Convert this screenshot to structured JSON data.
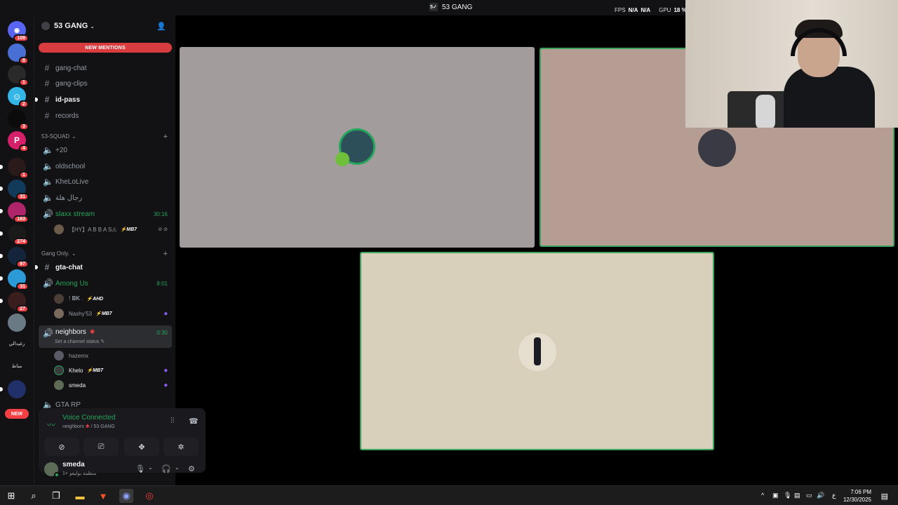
{
  "window": {
    "title": "53 GANG",
    "title_icon": "5✓",
    "overlay": {
      "fps_label": "FPS",
      "fps_values": [
        "N/A",
        "N/A"
      ],
      "gpu_label": "GPU",
      "gpu_value": "18 %"
    }
  },
  "server_rail": {
    "servers": [
      {
        "name": "direct-messages",
        "badge": "109",
        "color": "#5865f2",
        "glyph": "◉"
      },
      {
        "name": "server-2",
        "badge": "8",
        "color": "#4a6fd4",
        "glyph": ""
      },
      {
        "name": "server-3",
        "badge": "1",
        "color": "#2a2a2a",
        "glyph": ""
      },
      {
        "name": "server-4",
        "badge": "2",
        "color": "#34b7e8",
        "glyph": "☺"
      },
      {
        "name": "server-5",
        "badge": "3",
        "color": "#0b0b0b",
        "glyph": ""
      },
      {
        "name": "server-6",
        "badge": "4",
        "color": "#d61f69",
        "glyph": "P"
      },
      {
        "name": "server-7",
        "badge": "1",
        "color": "#2b1a1a",
        "glyph": ""
      },
      {
        "name": "server-8",
        "badge": "31",
        "color": "#123a5a",
        "glyph": ""
      },
      {
        "name": "server-9",
        "badge": "163",
        "color": "#b0246a",
        "glyph": ""
      },
      {
        "name": "server-10",
        "badge": "274",
        "color": "#1a1a1a",
        "glyph": ""
      },
      {
        "name": "server-11",
        "badge": "97",
        "color": "#14243a",
        "glyph": ""
      },
      {
        "name": "server-12",
        "badge": "31",
        "color": "#2d9ad8",
        "glyph": ""
      },
      {
        "name": "server-13",
        "badge": "27",
        "color": "#3a1e1e",
        "glyph": ""
      },
      {
        "name": "server-14",
        "badge": "",
        "color": "#6a7a84",
        "glyph": ""
      }
    ],
    "text_servers": [
      "رغيدالي",
      "مناط"
    ],
    "new_label": "NEW"
  },
  "guild": {
    "name": "53 GANG",
    "new_mentions": "NEW MENTIONS"
  },
  "channels": {
    "top": [
      {
        "name": "gang-chat",
        "unread": false
      },
      {
        "name": "gang-clips",
        "unread": false
      },
      {
        "name": "id-pass",
        "unread": true
      },
      {
        "name": "records",
        "unread": false
      }
    ],
    "cat_squad": "53-SQUAD",
    "squad": [
      {
        "name": "+20"
      },
      {
        "name": "oldschool"
      },
      {
        "name": "KheLoLive"
      },
      {
        "name": "رجال هلة"
      }
    ],
    "slaxx": {
      "name": "slaxx stream",
      "timer": "30:16"
    },
    "slaxx_user": {
      "name": "【HY】A B B A S⚠",
      "tag": "⚡MB7",
      "act": "⊘ ⊘"
    },
    "cat_gang": "Gang Only.",
    "gta_chat": "gta-chat",
    "among": {
      "name": "Among Us",
      "timer": "8:01"
    },
    "among_users": [
      {
        "name": "! 𝐁𝐊 .",
        "tag": "⚡AHD",
        "act": ""
      },
      {
        "name": "Nashy'53",
        "tag": "⚡MB7",
        "act": "◆"
      }
    ],
    "neighbors": {
      "name": "neighbors",
      "timer": "0:30",
      "status": "Set a channel status"
    },
    "neighbors_users": [
      {
        "name": "hazemx",
        "tag": "",
        "act": ""
      },
      {
        "name": "Khelo",
        "tag": "⚡MB7",
        "act": "◆"
      },
      {
        "name": "smeda",
        "tag": "",
        "act": "◆"
      }
    ],
    "gta_rp": "GTA RP"
  },
  "voice_panel": {
    "title": "Voice Connected",
    "channel": "neighbors",
    "guild": "/ 53 GANG"
  },
  "user_panel": {
    "name": "smeda",
    "status": "منظمة بوليفو +1"
  },
  "taskbar": {
    "time": "7:06 PM",
    "date": "12/30/2025",
    "lang": "ع"
  },
  "colors": {
    "accent_green": "#23a55a",
    "mention_red": "#d83c3e",
    "tile1": "#a39c9d",
    "tile2": "#b59d94",
    "tile3": "#d9d0bc"
  }
}
